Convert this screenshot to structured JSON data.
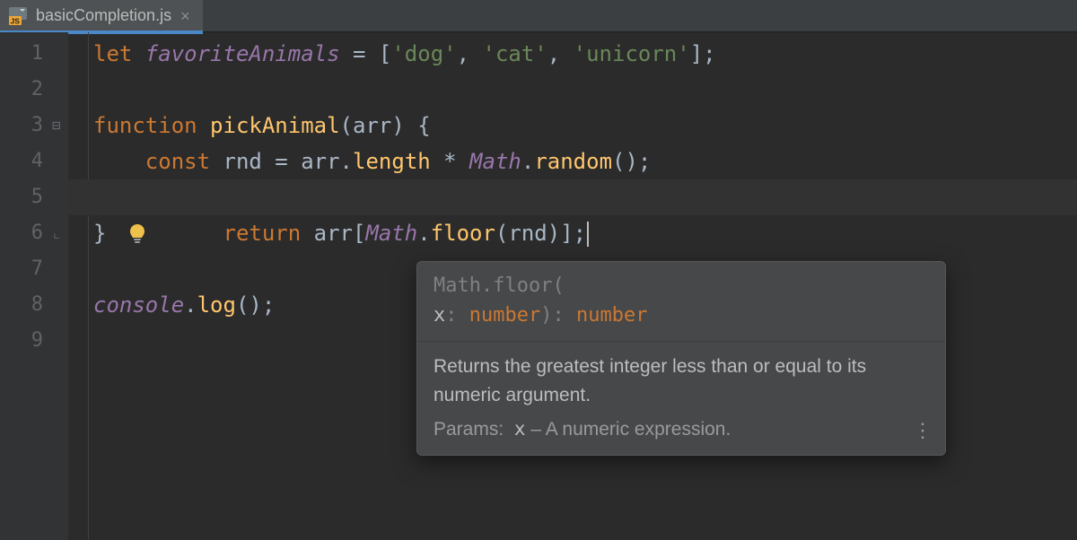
{
  "tab": {
    "filename": "basicCompletion.js",
    "icon": "js-file-icon"
  },
  "gutter": {
    "line_numbers": [
      "1",
      "2",
      "3",
      "4",
      "5",
      "6",
      "7",
      "8",
      "9"
    ]
  },
  "code": {
    "l1": {
      "let": "let ",
      "var": "favoriteAnimals",
      "assign": " = [",
      "s1": "'dog'",
      "c1": ", ",
      "s2": "'cat'",
      "c2": ", ",
      "s3": "'unicorn'",
      "end": "];"
    },
    "l3": {
      "fn": "function ",
      "name": "pickAnimal",
      "params": "(arr) {"
    },
    "l4": {
      "indent": "    ",
      "const": "const ",
      "rnd": "rnd",
      "eq": " = arr.",
      "len": "length",
      "mul": " * ",
      "math": "Math",
      "dot": ".",
      "rand": "random",
      "paren": "();"
    },
    "l5": {
      "indent": "    ",
      "ret": "return ",
      "arr": "arr[",
      "math": "Math",
      "dot": ".",
      "floor": "floor",
      "tail": "(rnd)];"
    },
    "l6": {
      "brace": "}"
    },
    "l8": {
      "console": "console",
      "dot": ".",
      "log": "log",
      "paren": "();"
    }
  },
  "popup": {
    "sig1a": "Math",
    "sig1b": ".",
    "sig1c": "floor",
    "sig1d": "(",
    "sig2pad": "    ",
    "sig2a": "x",
    "sig2b": ": ",
    "sig2c": "number",
    "sig2d": ")",
    "sig2e": ": ",
    "sig2f": "number",
    "doc": "Returns the greatest integer less than or equal to its numeric argument.",
    "params_label": "Params:",
    "params_name": "x",
    "params_sep": " – ",
    "params_desc": "A numeric expression."
  }
}
